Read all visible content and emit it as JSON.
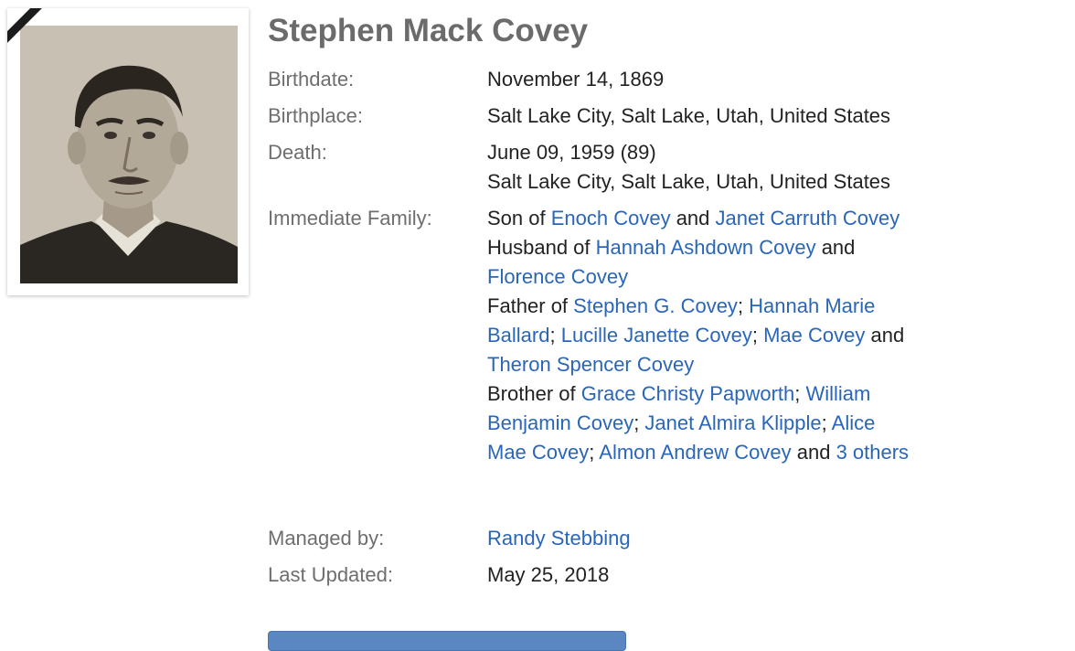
{
  "profile": {
    "name": "Stephen Mack Covey",
    "birthdate_label": "Birthdate:",
    "birthdate": "November 14, 1869",
    "birthplace_label": "Birthplace:",
    "birthplace": "Salt Lake City, Salt Lake, Utah, United States",
    "death_label": "Death:",
    "death_date": "June 09, 1959 (89)",
    "death_place": "Salt Lake City, Salt Lake, Utah, United States",
    "family_label": "Immediate Family:",
    "managed_by_label": "Managed by:",
    "managed_by": "Randy Stebbing",
    "last_updated_label": "Last Updated:",
    "last_updated": "May 25, 2018"
  },
  "family": {
    "son_of": "Son of ",
    "father_name": "Enoch Covey",
    "and_1": " and ",
    "mother_name": "Janet Carruth Covey",
    "husband_of": "Husband of ",
    "spouse_1": "Hannah Ashdown Covey",
    "and_2": " and",
    "spouse_2": "Florence Covey",
    "father_of": "Father of ",
    "child_1": "Stephen G. Covey",
    "sep_1": "; ",
    "child_2a": "Hannah Marie",
    "child_2b": "Ballard",
    "sep_2": "; ",
    "child_3": "Lucille Janette Covey",
    "sep_3": "; ",
    "child_4": "Mae Covey",
    "and_3": " and",
    "child_5": "Theron Spencer Covey",
    "brother_of": "Brother of ",
    "sibling_1": "Grace Christy Papworth",
    "sep_4": "; ",
    "sibling_2a": "William",
    "sibling_2b": "Benjamin Covey",
    "sep_5": "; ",
    "sibling_3": "Janet Almira Klipple",
    "sep_6": "; ",
    "sibling_4a": "Alice",
    "sibling_4b": "Mae Covey",
    "sep_7": "; ",
    "sibling_5": "Almon Andrew Covey",
    "and_4": " and ",
    "others": "3 others"
  },
  "colors": {
    "link": "#2a66b8",
    "label": "#6e6e6e",
    "title": "#6b6b6b",
    "button": "#5a86c2"
  }
}
